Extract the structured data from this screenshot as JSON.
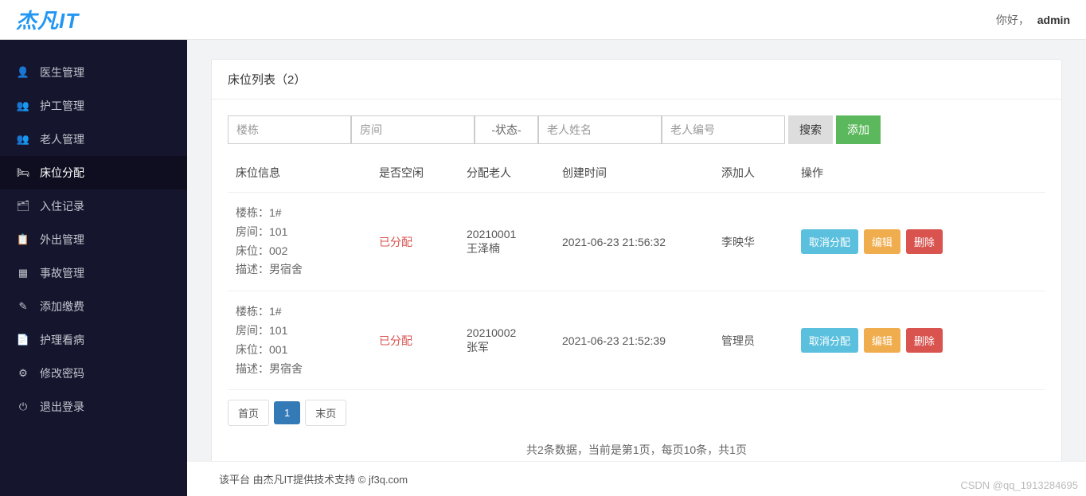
{
  "header": {
    "logo": "杰凡IT",
    "greeting_prefix": "你好，",
    "username": "admin"
  },
  "sidebar": {
    "items": [
      {
        "icon": "👤",
        "label": "医生管理"
      },
      {
        "icon": "👥",
        "label": "护工管理"
      },
      {
        "icon": "👥",
        "label": "老人管理"
      },
      {
        "icon": "🛏",
        "label": "床位分配"
      },
      {
        "icon": "🗂",
        "label": "入住记录"
      },
      {
        "icon": "📋",
        "label": "外出管理"
      },
      {
        "icon": "▦",
        "label": "事故管理"
      },
      {
        "icon": "✎",
        "label": "添加缴费"
      },
      {
        "icon": "📄",
        "label": "护理看病"
      },
      {
        "icon": "⚙",
        "label": "修改密码"
      },
      {
        "icon": "⏻",
        "label": "退出登录"
      }
    ]
  },
  "card": {
    "title": "床位列表（2）"
  },
  "filters": {
    "building_ph": "楼栋",
    "room_ph": "房间",
    "status_option": "-状态-",
    "elder_name_ph": "老人姓名",
    "elder_no_ph": "老人编号",
    "search_label": "搜索",
    "add_label": "添加"
  },
  "table": {
    "headers": [
      "床位信息",
      "是否空闲",
      "分配老人",
      "创建时间",
      "添加人",
      "操作"
    ],
    "rows": [
      {
        "bed": {
          "building": "楼栋：1#",
          "room": "房间：101",
          "no": "床位：002",
          "desc": "描述：男宿舍"
        },
        "status": "已分配",
        "elder_no": "20210001",
        "elder_name": "王泽楠",
        "created": "2021-06-23 21:56:32",
        "adder": "李映华"
      },
      {
        "bed": {
          "building": "楼栋：1#",
          "room": "房间：101",
          "no": "床位：001",
          "desc": "描述：男宿舍"
        },
        "status": "已分配",
        "elder_no": "20210002",
        "elder_name": "张军",
        "created": "2021-06-23 21:52:39",
        "adder": "管理员"
      }
    ],
    "actions": {
      "cancel": "取消分配",
      "edit": "编辑",
      "del": "删除"
    }
  },
  "pagination": {
    "first": "首页",
    "page1": "1",
    "last": "末页",
    "summary": "共2条数据，当前是第1页，每页10条，共1页"
  },
  "footer": {
    "text": "该平台 由杰凡IT提供技术支持 © jf3q.com"
  },
  "watermark": "CSDN @qq_1913284695"
}
